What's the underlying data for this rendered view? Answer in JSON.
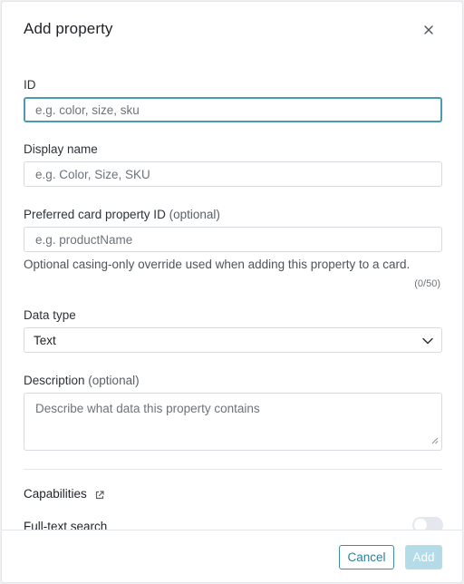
{
  "dialog": {
    "title": "Add property",
    "close_icon": "close-icon"
  },
  "fields": {
    "id": {
      "label": "ID",
      "value": "",
      "placeholder": "e.g. color, size, sku"
    },
    "display_name": {
      "label": "Display name",
      "value": "",
      "placeholder": "e.g. Color, Size, SKU"
    },
    "card_property_id": {
      "label": "Preferred card property ID",
      "optional": "(optional)",
      "value": "",
      "placeholder": "e.g. productName",
      "help": "Optional casing-only override used when adding this property to a card.",
      "counter": "(0/50)"
    },
    "data_type": {
      "label": "Data type",
      "selected": "Text",
      "icon": "chevron-down-icon"
    },
    "description": {
      "label": "Description",
      "optional": "(optional)",
      "value": "",
      "placeholder": "Describe what data this property contains"
    }
  },
  "capabilities": {
    "title": "Capabilities",
    "icon": "external-link-icon",
    "items": [
      {
        "label": "Full-text search",
        "enabled": false
      }
    ]
  },
  "footer": {
    "cancel_label": "Cancel",
    "add_label": "Add"
  },
  "colors": {
    "accent": "#3d8ea5",
    "focus_border": "#4a9ab0",
    "add_disabled": "#b3dce8"
  }
}
